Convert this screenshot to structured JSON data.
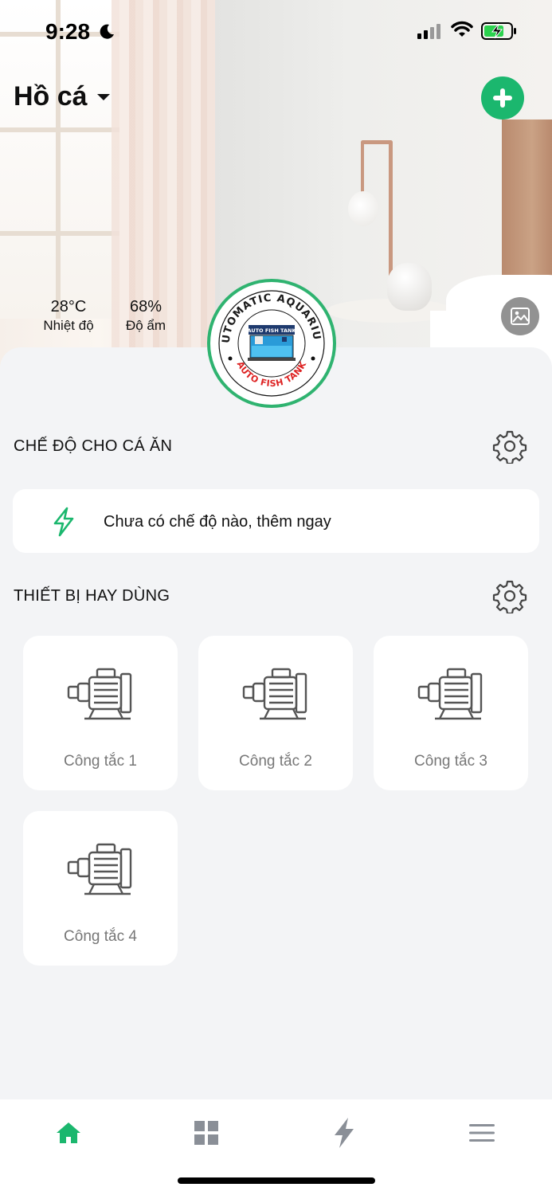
{
  "status_bar": {
    "time": "9:28"
  },
  "header": {
    "home_name": "Hồ cá",
    "icons": {
      "dropdown": "caret-down-icon",
      "add": "plus-circle-icon",
      "photo": "image-icon"
    }
  },
  "climate": {
    "temperature": {
      "value": "28°C",
      "label": "Nhiệt độ"
    },
    "humidity": {
      "value": "68%",
      "label": "Độ ẩm"
    }
  },
  "logo": {
    "top_text": "AUTOMATIC AQUARIUM",
    "center_text": "AUTO FISH TANK",
    "bottom_text": "AUTO FISH TANK"
  },
  "feeding": {
    "title": "CHẾ ĐỘ CHO CÁ ĂN",
    "empty_text": "Chưa có chế độ nào, thêm ngay"
  },
  "devices": {
    "title": "THIẾT BỊ HAY DÙNG",
    "items": [
      {
        "name": "Công tắc 1",
        "icon": "motor-icon"
      },
      {
        "name": "Công tắc 2",
        "icon": "motor-icon"
      },
      {
        "name": "Công tắc 3",
        "icon": "motor-icon"
      },
      {
        "name": "Công tắc 4",
        "icon": "motor-icon"
      }
    ]
  },
  "tabbar": {
    "tabs": [
      {
        "icon": "home-icon",
        "active": true
      },
      {
        "icon": "grid-icon",
        "active": false
      },
      {
        "icon": "bolt-icon",
        "active": false
      },
      {
        "icon": "menu-icon",
        "active": false
      }
    ]
  },
  "colors": {
    "accent": "#1bb76e",
    "background": "#f3f4f6",
    "inactive_icon": "#8a8f97"
  }
}
